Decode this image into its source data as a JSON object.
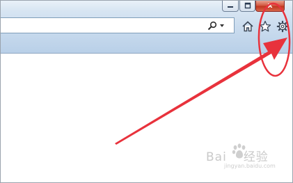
{
  "window_controls": {
    "minimize_icon": "minimize-icon",
    "maximize_icon": "restore-icon",
    "close_label": "x"
  },
  "address_bar": {
    "value": "",
    "search_icon": "search-icon",
    "dropdown_icon": "chevron-down-icon"
  },
  "toolbar": {
    "icons": [
      "home-icon",
      "star-icon",
      "gear-icon"
    ]
  },
  "annotation": {
    "color": "#e8323c",
    "shape": "arrow pointing to highlighted gear icon"
  },
  "watermark": {
    "brand_text": "Bai",
    "brand_suffix": "经验",
    "subtext": "jingyan.baidu.com"
  },
  "colors": {
    "chrome_top": "#e9f1f8",
    "chrome_bottom": "#b9d0e8",
    "close_button": "#c1371f"
  }
}
